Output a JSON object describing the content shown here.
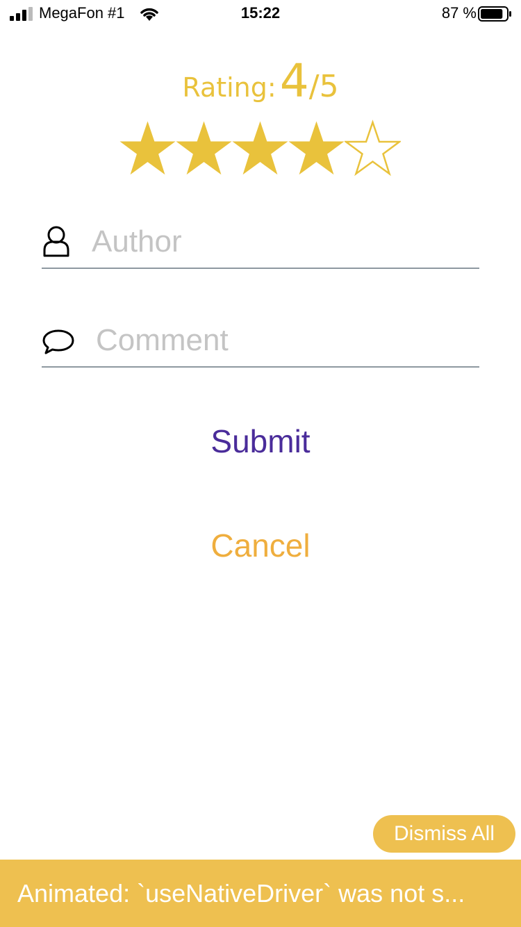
{
  "status_bar": {
    "carrier": "MegaFon #1",
    "time": "15:22",
    "battery_percent": "87 %",
    "signal_icon": "signal-bars-icon",
    "wifi_icon": "wifi-icon",
    "battery_icon": "battery-icon",
    "battery_level": 0.87
  },
  "rating": {
    "label": "Rating:",
    "value": "4",
    "separator": "/",
    "max": "5",
    "filled_stars": 4,
    "total_stars": 5,
    "color": "#E9C23C"
  },
  "form": {
    "author": {
      "placeholder": "Author",
      "value": "",
      "icon": "person-icon"
    },
    "comment": {
      "placeholder": "Comment",
      "value": "",
      "icon": "speech-bubble-icon"
    }
  },
  "actions": {
    "submit_label": "Submit",
    "submit_color": "#4A2C9A",
    "cancel_label": "Cancel",
    "cancel_color": "#EFAE3E"
  },
  "warning": {
    "dismiss_all_label": "Dismiss All",
    "message": "Animated: `useNativeDriver` was not s...",
    "color": "#EEC050"
  }
}
